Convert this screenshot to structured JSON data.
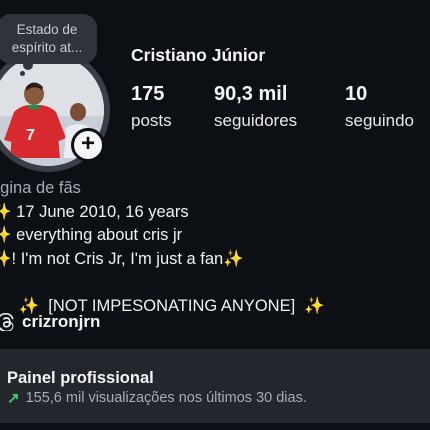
{
  "mood_bubble": {
    "text": "Estado de espírito at..."
  },
  "profile": {
    "name": "Cristiano Júnior",
    "stats": [
      {
        "value": "175",
        "label": "posts"
      },
      {
        "value": "90,3 mil",
        "label": "seguidores"
      },
      {
        "value": "10",
        "label": "seguindo"
      }
    ]
  },
  "bio": {
    "category": "ágina de fãs",
    "lines": [
      {
        "prefix": "✨",
        "text": " 17 June 2010, 16 years"
      },
      {
        "prefix": "✨",
        "text": " everything about cris jr"
      },
      {
        "prefix": "✨",
        "text": "! I'm not Cris Jr, I'm just a fan",
        "suffix": "✨"
      },
      {
        "prefix": "✨",
        "text": "  [NOT IMPESONATING ANYONE]  ",
        "suffix": "✨"
      }
    ]
  },
  "threads": {
    "handle": "crizronjrn",
    "icon": "threads-icon"
  },
  "pro_panel": {
    "title": "Painel profissional",
    "subtitle": "155,6 mil visualizações nos últimos 30 dias.",
    "icon": "trend-up-icon",
    "accent": "#3fcf6b"
  },
  "colors": {
    "background": "#0c0f14",
    "panel": "#23272d",
    "mood_bubble": "#2f333a"
  }
}
